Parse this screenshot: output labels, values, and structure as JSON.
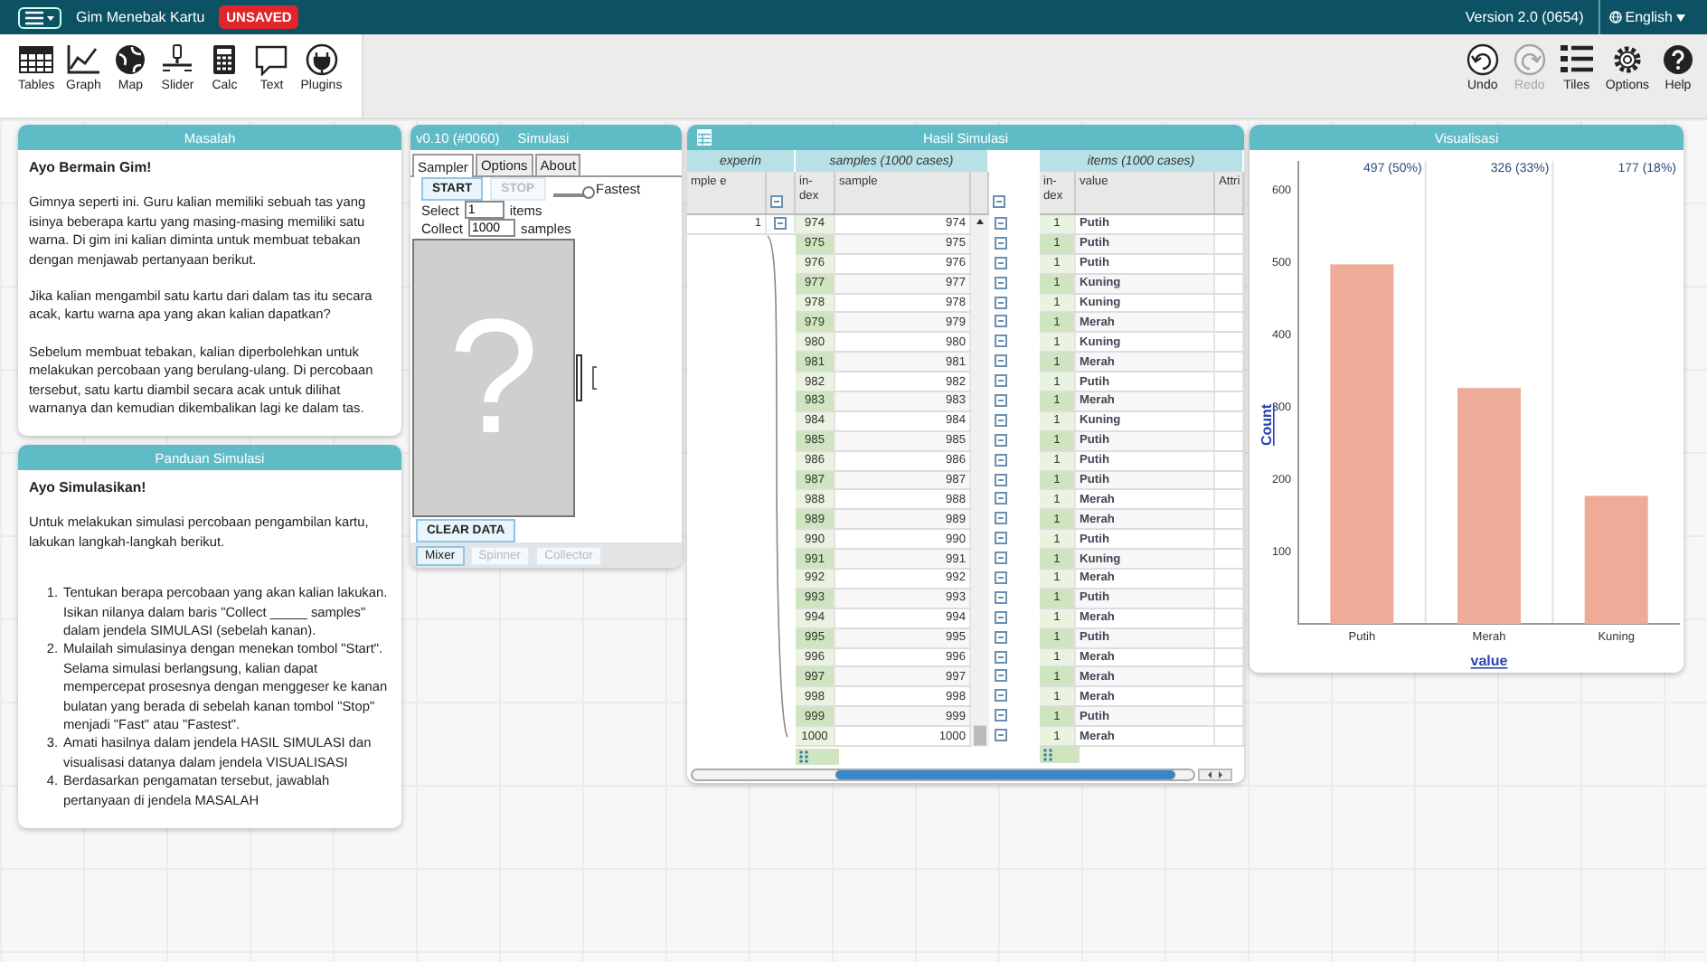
{
  "menu_bar": {
    "title": "Gim Menebak Kartu",
    "badge": "UNSAVED",
    "version": "Version 2.0 (0654)",
    "language": "English"
  },
  "toolbar": {
    "tools": [
      {
        "label": "Tables"
      },
      {
        "label": "Graph"
      },
      {
        "label": "Map"
      },
      {
        "label": "Slider"
      },
      {
        "label": "Calc"
      },
      {
        "label": "Text"
      },
      {
        "label": "Plugins"
      }
    ],
    "right_tools": [
      {
        "label": "Undo",
        "disabled": false
      },
      {
        "label": "Redo",
        "disabled": true
      },
      {
        "label": "Tiles",
        "disabled": false
      },
      {
        "label": "Options",
        "disabled": false
      },
      {
        "label": "Help",
        "disabled": false
      }
    ]
  },
  "problem_tile": {
    "title": "Masalah",
    "heading": "Ayo Bermain Gim!",
    "paragraphs": [
      "Gimnya seperti ini. Guru kalian memiliki sebuah tas yang isinya beberapa kartu yang masing-masing memiliki satu warna. Di gim ini kalian diminta untuk membuat tebakan dengan menjawab pertanyaan berikut.",
      "Jika kalian mengambil satu kartu dari dalam tas itu secara acak, kartu warna apa yang akan kalian dapatkan?",
      "Sebelum membuat tebakan, kalian diperbolehkan untuk melakukan percobaan yang berulang-ulang. Di percobaan tersebut, satu kartu diambil secara acak untuk dilihat warnanya dan kemudian dikembalikan lagi ke dalam tas."
    ]
  },
  "guide_tile": {
    "title": "Panduan Simulasi",
    "heading": "Ayo Simulasikan!",
    "intro": "Untuk melakukan simulasi percobaan pengambilan kartu, lakukan langkah-langkah berikut.",
    "steps": [
      {
        "number": "1.",
        "text": "Tentukan berapa percobaan yang akan kalian lakukan. Isikan nilanya dalam baris \"Collect _____ samples\" dalam jendela SIMULASI (sebelah kanan)."
      },
      {
        "number": "2.",
        "text": "Mulailah simulasinya dengan menekan tombol \"Start\". Selama simulasi berlangsung, kalian dapat mempercepat prosesnya dengan menggeser ke kanan bulatan yang berada di sebelah kanan tombol \"Stop\" menjadi \"Fast\" atau \"Fastest\"."
      },
      {
        "number": "3.",
        "text": "Amati hasilnya dalam jendela HASIL SIMULASI dan visualisasi datanya dalam jendela VISUALISASI"
      },
      {
        "number": "4.",
        "text": "Berdasarkan pengamatan tersebut, jawablah pertanyaan di jendela MASALAH"
      }
    ]
  },
  "simulator_tile": {
    "version": "v0.10 (#0060)",
    "title": "Simulasi",
    "tabs": [
      {
        "label": "Sampler",
        "selected": true
      },
      {
        "label": "Options",
        "selected": false
      },
      {
        "label": "About",
        "selected": false
      }
    ],
    "start_button": {
      "label": "START",
      "disabled": false
    },
    "stop_button": {
      "label": "STOP",
      "disabled": true
    },
    "speed": {
      "label": "Fastest",
      "level": 1
    },
    "select_row": {
      "label": "Select",
      "value": "1",
      "unit": "items"
    },
    "collect_row": {
      "label": "Collect",
      "value": "1000",
      "unit": "samples"
    },
    "mixer_glyph": "?",
    "clear_button": "CLEAR DATA",
    "device_tabs": [
      {
        "label": "Mixer",
        "selected": true
      },
      {
        "label": "Spinner",
        "selected": false
      },
      {
        "label": "Collector",
        "selected": false
      }
    ]
  },
  "results_tile": {
    "title": "Hasil Simulasi",
    "parent": {
      "title": "experin",
      "columns": [
        "mple e"
      ],
      "rows": [
        [
          "1"
        ]
      ]
    },
    "samples": {
      "title": "samples (1000 cases)",
      "columns": [
        "in-dex",
        "sample"
      ],
      "rows": [
        [
          "974",
          "974"
        ],
        [
          "975",
          "975"
        ],
        [
          "976",
          "976"
        ],
        [
          "977",
          "977"
        ],
        [
          "978",
          "978"
        ],
        [
          "979",
          "979"
        ],
        [
          "980",
          "980"
        ],
        [
          "981",
          "981"
        ],
        [
          "982",
          "982"
        ],
        [
          "983",
          "983"
        ],
        [
          "984",
          "984"
        ],
        [
          "985",
          "985"
        ],
        [
          "986",
          "986"
        ],
        [
          "987",
          "987"
        ],
        [
          "988",
          "988"
        ],
        [
          "989",
          "989"
        ],
        [
          "990",
          "990"
        ],
        [
          "991",
          "991"
        ],
        [
          "992",
          "992"
        ],
        [
          "993",
          "993"
        ],
        [
          "994",
          "994"
        ],
        [
          "995",
          "995"
        ],
        [
          "996",
          "996"
        ],
        [
          "997",
          "997"
        ],
        [
          "998",
          "998"
        ],
        [
          "999",
          "999"
        ],
        [
          "1000",
          "1000"
        ]
      ]
    },
    "items": {
      "title": "items (1000 cases)",
      "columns": [
        "in-dex",
        "value",
        "Attri"
      ],
      "rows": [
        [
          "1",
          "Putih"
        ],
        [
          "1",
          "Putih"
        ],
        [
          "1",
          "Putih"
        ],
        [
          "1",
          "Kuning"
        ],
        [
          "1",
          "Kuning"
        ],
        [
          "1",
          "Merah"
        ],
        [
          "1",
          "Kuning"
        ],
        [
          "1",
          "Merah"
        ],
        [
          "1",
          "Putih"
        ],
        [
          "1",
          "Merah"
        ],
        [
          "1",
          "Kuning"
        ],
        [
          "1",
          "Putih"
        ],
        [
          "1",
          "Putih"
        ],
        [
          "1",
          "Putih"
        ],
        [
          "1",
          "Merah"
        ],
        [
          "1",
          "Merah"
        ],
        [
          "1",
          "Putih"
        ],
        [
          "1",
          "Kuning"
        ],
        [
          "1",
          "Merah"
        ],
        [
          "1",
          "Putih"
        ],
        [
          "1",
          "Merah"
        ],
        [
          "1",
          "Putih"
        ],
        [
          "1",
          "Merah"
        ],
        [
          "1",
          "Merah"
        ],
        [
          "1",
          "Merah"
        ],
        [
          "1",
          "Putih"
        ],
        [
          "1",
          "Merah"
        ]
      ]
    }
  },
  "graph_tile": {
    "title": "Visualisasi",
    "cell_counts": [
      "497 (50%)",
      "326 (33%)",
      "177 (18%)"
    ],
    "chart_data": {
      "type": "bar",
      "xlabel": "value",
      "ylabel": "Count",
      "categories": [
        "Putih",
        "Merah",
        "Kuning"
      ],
      "values": [
        497,
        326,
        177
      ],
      "ylim": [
        0,
        640
      ],
      "yticks": [
        100,
        200,
        300,
        400,
        500,
        600
      ]
    }
  }
}
